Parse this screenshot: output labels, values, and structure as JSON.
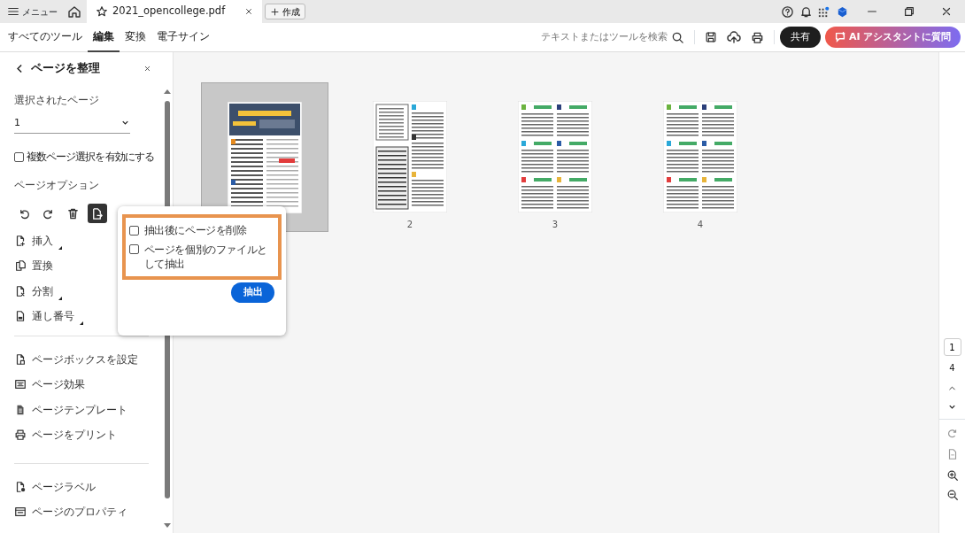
{
  "window": {
    "menu": "メニュー",
    "document_tab": {
      "title": "2021_opencollege.pdf"
    },
    "create_button": "作成"
  },
  "toolbar": {
    "tabs": [
      {
        "label": "すべてのツール",
        "selected": false
      },
      {
        "label": "編集",
        "selected": true
      },
      {
        "label": "変換",
        "selected": false
      },
      {
        "label": "電子サイン",
        "selected": false
      }
    ],
    "search": {
      "placeholder": "テキストまたはツールを検索"
    },
    "share_button": "共有",
    "ai_button": "AI アシスタントに質問"
  },
  "panel": {
    "title": "ページを整理",
    "selected_pages_label": "選択されたページ",
    "selected_page": "1",
    "multi_select": {
      "label": "複数ページ選択を有効にする",
      "checked": false
    },
    "options_label": "ページオプション",
    "page_tools": [
      {
        "kind": "rotate-left",
        "selected": false
      },
      {
        "kind": "rotate-right",
        "selected": false
      },
      {
        "kind": "delete",
        "selected": false
      },
      {
        "kind": "extract",
        "selected": true
      }
    ],
    "option_groups": [
      [
        {
          "label": "挿入",
          "kind": "insert",
          "submenu": true
        },
        {
          "label": "置換",
          "kind": "replace",
          "submenu": false
        },
        {
          "label": "分割",
          "kind": "split",
          "submenu": true
        },
        {
          "label": "通し番号",
          "kind": "number",
          "submenu": true
        }
      ],
      [
        {
          "label": "ページボックスを設定",
          "kind": "box",
          "submenu": false
        },
        {
          "label": "ページ効果",
          "kind": "effect",
          "submenu": false
        },
        {
          "label": "ページテンプレート",
          "kind": "template",
          "submenu": false
        },
        {
          "label": "ページをプリント",
          "kind": "print",
          "submenu": false
        }
      ],
      [
        {
          "label": "ページラベル",
          "kind": "label",
          "submenu": false
        },
        {
          "label": "ページのプロパティ",
          "kind": "props",
          "submenu": false
        }
      ]
    ]
  },
  "extract_popup": {
    "options": [
      {
        "label": "抽出後にページを削除",
        "checked": false
      },
      {
        "label": "ページを個別のファイルとして抽出",
        "checked": false
      }
    ],
    "button": "抽出"
  },
  "pages": [
    {
      "kind": "cover",
      "selected": true
    },
    {
      "number": "2",
      "kind": "form",
      "selected": false
    },
    {
      "number": "3",
      "kind": "listing",
      "selected": false
    },
    {
      "number": "4",
      "kind": "listing",
      "selected": false
    }
  ],
  "page_nav": {
    "current": "1",
    "total": "4"
  }
}
